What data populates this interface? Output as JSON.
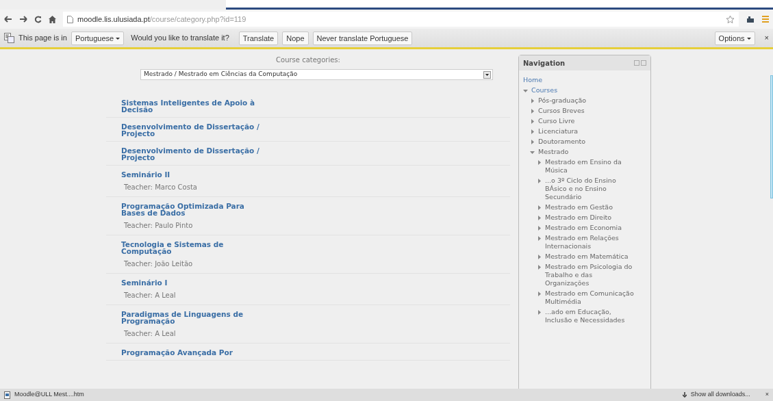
{
  "browser": {
    "url_host": "moodle.lis.ulusiada.pt",
    "url_path": "/course/category.php?id=119"
  },
  "translate_bar": {
    "prefix": "This page is in",
    "language": "Portuguese",
    "question": "Would you like to translate it?",
    "buttons": [
      "Translate",
      "Nope",
      "Never translate Portuguese"
    ],
    "options": "Options",
    "close": "×"
  },
  "categories": {
    "label": "Course categories:",
    "value": "Mestrado / Mestrado em Ciências da Computação"
  },
  "courses": [
    {
      "title": "Sistemas Inteligentes de Apoio à Decisão"
    },
    {
      "title": "Desenvolvimento de Dissertação / Projecto"
    },
    {
      "title": "Desenvolvimento de Dissertação / Projecto"
    },
    {
      "title": "Seminário II",
      "teacher_label": "Teacher:",
      "teacher": "Marco Costa"
    },
    {
      "title": "Programação Optimizada Para Bases de Dados",
      "teacher_label": "Teacher:",
      "teacher": "Paulo Pinto"
    },
    {
      "title": "Tecnologia e Sistemas de Computação",
      "teacher_label": "Teacher:",
      "teacher": "João Leitão"
    },
    {
      "title": "Seminário I",
      "teacher_label": "Teacher:",
      "teacher": "A Leal"
    },
    {
      "title": "Paradigmas de Linguagens de Programação",
      "teacher_label": "Teacher:",
      "teacher": "A Leal"
    },
    {
      "title": "Programação Avançada Por"
    }
  ],
  "navigation": {
    "title": "Navigation",
    "items": [
      {
        "label": "Home",
        "kind": "link"
      },
      {
        "label": "Courses",
        "kind": "branch",
        "expanded": true,
        "children": [
          {
            "label": "Pós-graduação",
            "kind": "branch",
            "expanded": false
          },
          {
            "label": "Cursos Breves",
            "kind": "branch",
            "expanded": false
          },
          {
            "label": "Curso Livre",
            "kind": "branch",
            "expanded": false
          },
          {
            "label": "Licenciatura",
            "kind": "branch",
            "expanded": false
          },
          {
            "label": "Doutoramento",
            "kind": "branch",
            "expanded": false
          },
          {
            "label": "Mestrado",
            "kind": "branch",
            "expanded": true,
            "children": [
              {
                "label": "Mestrado em Ensino da Música",
                "kind": "branch",
                "expanded": false
              },
              {
                "label": "...o 3º Ciclo do Ensino BÁsico e no Ensino Secundário",
                "kind": "branch",
                "expanded": false
              },
              {
                "label": "Mestrado em Gestão",
                "kind": "branch",
                "expanded": false
              },
              {
                "label": "Mestrado em Direito",
                "kind": "branch",
                "expanded": false
              },
              {
                "label": "Mestrado em Economia",
                "kind": "branch",
                "expanded": false
              },
              {
                "label": "Mestrado em Relações Internacionais",
                "kind": "branch",
                "expanded": false
              },
              {
                "label": "Mestrado em Matemática",
                "kind": "branch",
                "expanded": false
              },
              {
                "label": "Mestrado em Psicologia do Trabalho e das Organizações",
                "kind": "branch",
                "expanded": false
              },
              {
                "label": "Mestrado em Comunicação Multimédia",
                "kind": "branch",
                "expanded": false
              },
              {
                "label": "...ado em Educação, Inclusão e Necessidades",
                "kind": "branch",
                "expanded": false
              }
            ]
          }
        ]
      }
    ]
  },
  "downloads": {
    "file": "Moodle@ULL Mest....htm",
    "show_all": "Show all downloads...",
    "close": "×"
  }
}
